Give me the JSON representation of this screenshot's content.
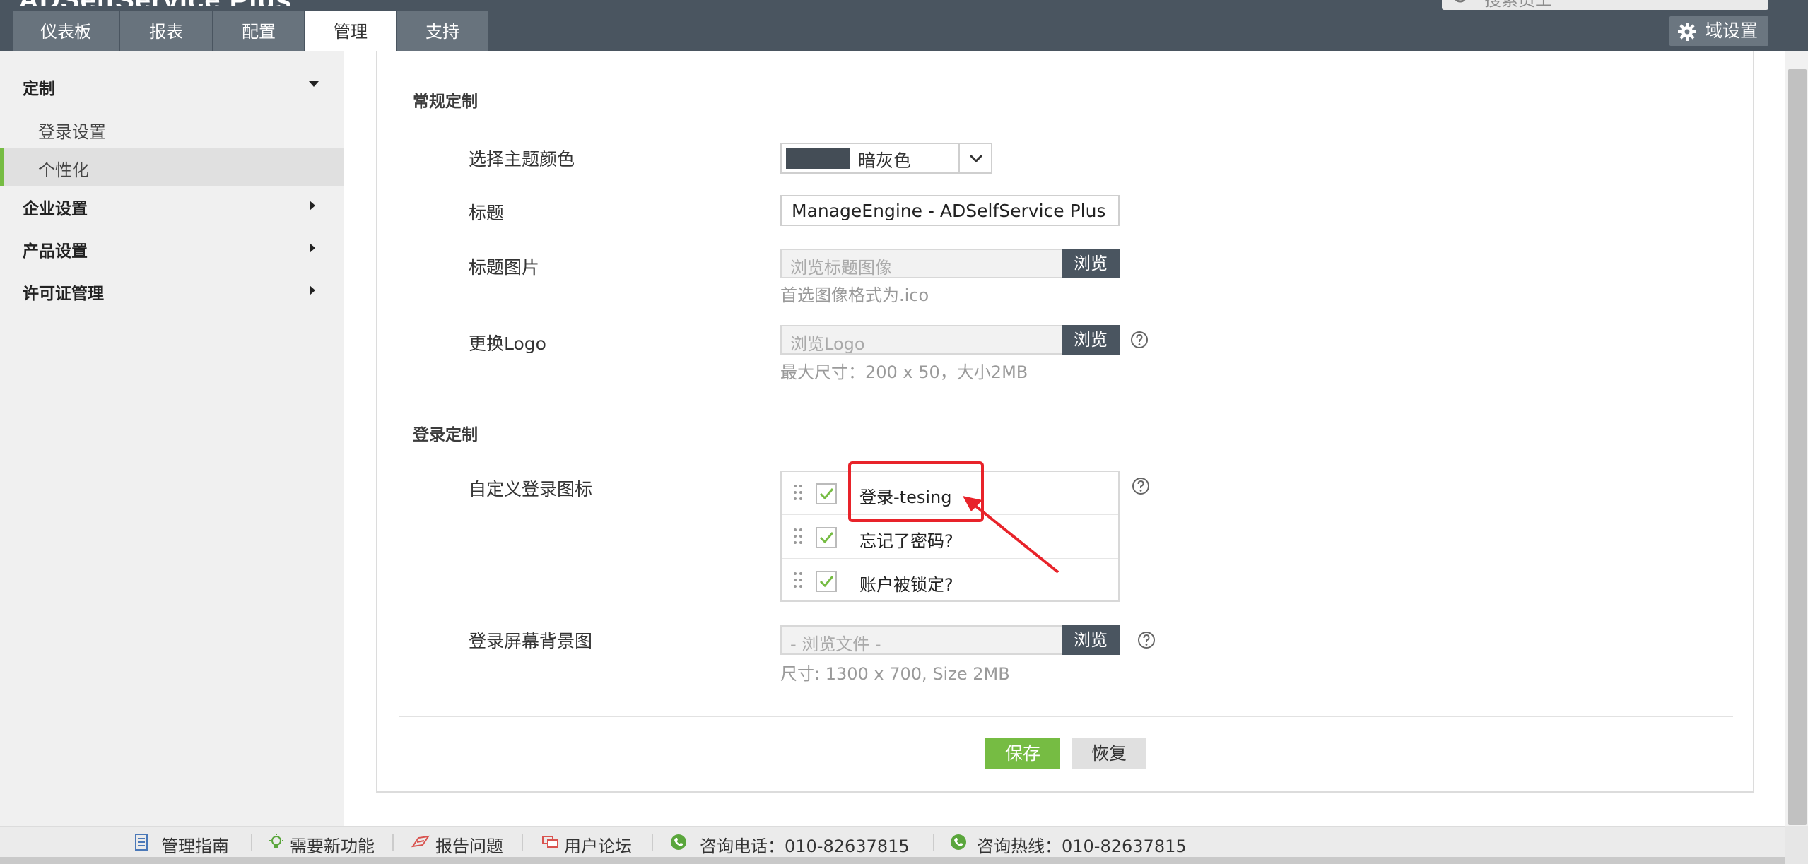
{
  "header": {
    "brand_text": "ADSelfService Plus",
    "search_placeholder": "搜索员工",
    "domain_settings_label": "域设置",
    "tabs": [
      {
        "label": "仪表板"
      },
      {
        "label": "报表"
      },
      {
        "label": "配置"
      },
      {
        "label": "管理",
        "active": true
      },
      {
        "label": "支持"
      }
    ]
  },
  "sidebar": {
    "customize": {
      "label": "定制",
      "expanded": true
    },
    "sub_items": [
      {
        "label": "登录设置"
      },
      {
        "label": "个性化",
        "active": true
      }
    ],
    "sections": [
      {
        "label": "企业设置"
      },
      {
        "label": "产品设置"
      },
      {
        "label": "许可证管理"
      }
    ]
  },
  "general": {
    "title": "常规定制",
    "theme_label": "选择主题颜色",
    "theme_value": "暗灰色",
    "theme_swatch_color": "#444d56",
    "title_label": "标题",
    "title_value": "ManageEngine - ADSelfService Plus",
    "title_image_label": "标题图片",
    "title_image_placeholder": "浏览标题图像",
    "title_image_hint": "首选图像格式为.ico",
    "logo_label": "更换Logo",
    "logo_placeholder": "浏览Logo",
    "logo_hint": "最大尺寸：200 x 50，大小2MB",
    "browse_label": "浏览"
  },
  "login": {
    "title": "登录定制",
    "icons_label": "自定义登录图标",
    "items": [
      {
        "label": "登录-tesing",
        "checked": true
      },
      {
        "label": "忘记了密码?",
        "checked": true
      },
      {
        "label": "账户被锁定?",
        "checked": true
      }
    ],
    "background_label": "登录屏幕背景图",
    "background_placeholder": "- 浏览文件 -",
    "background_hint": "尺寸: 1300 x 700, Size 2MB"
  },
  "actions": {
    "save_label": "保存",
    "reset_label": "恢复"
  },
  "footer": {
    "items": [
      {
        "label": "管理指南",
        "icon": "document-icon"
      },
      {
        "label": "需要新功能",
        "icon": "lightbulb-icon"
      },
      {
        "label": "报告问题",
        "icon": "report-icon"
      },
      {
        "label": "用户论坛",
        "icon": "forum-icon"
      },
      {
        "label": "咨询电话：010-82637815",
        "icon": "phone-icon"
      },
      {
        "label": "咨询热线：010-82637815",
        "icon": "phone-icon"
      }
    ]
  },
  "colors": {
    "header_bg": "#4a5560",
    "accent_green": "#76bc43",
    "annotation_red": "#e8232a"
  }
}
